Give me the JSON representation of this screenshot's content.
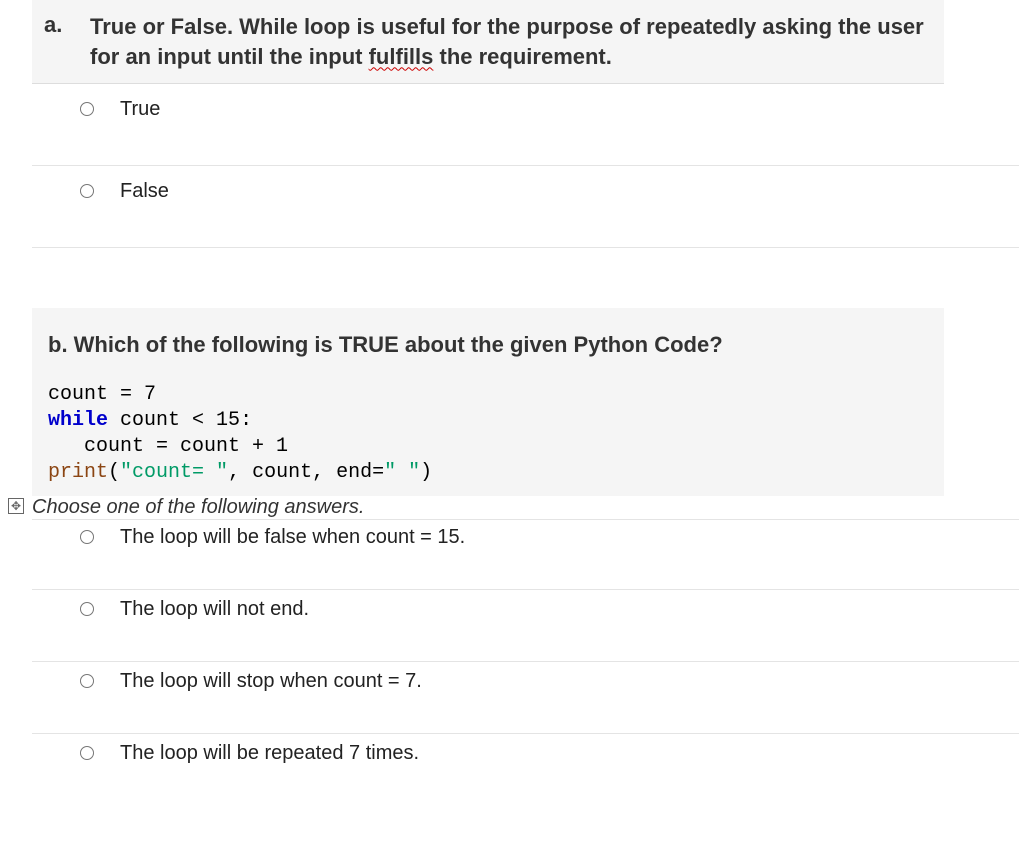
{
  "questionA": {
    "marker": "a.",
    "text_parts": {
      "before": "True or False. While loop is useful for the purpose of repeatedly asking the user for an input until the input ",
      "underlined": "fulfills",
      "after": " the requirement."
    },
    "options": [
      {
        "label": "True"
      },
      {
        "label": "False"
      }
    ]
  },
  "questionB": {
    "title": "b. Which of the following is TRUE about the given Python Code?",
    "code": {
      "line1_a": "count = ",
      "line1_b": "7",
      "line2_a": "while",
      "line2_b": " count < ",
      "line2_c": "15",
      "line2_d": ":",
      "line3": "   count = count + 1",
      "line4_a": "print",
      "line4_b": "(",
      "line4_c": "\"count= \"",
      "line4_d": ", count, end=",
      "line4_e": "\" \"",
      "line4_f": ")"
    },
    "instruction": "Choose one of the following answers.",
    "options": [
      {
        "label": "The loop will be false when count = 15."
      },
      {
        "label": "The loop will not end."
      },
      {
        "label": "The loop will stop when count = 7."
      },
      {
        "label": "The loop will be repeated 7 times."
      }
    ]
  }
}
